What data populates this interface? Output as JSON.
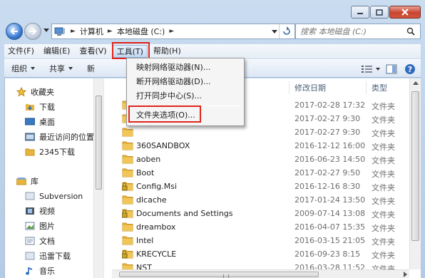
{
  "window": {
    "colors": {
      "accent_red": "#e0261c",
      "folder_yellow": "#e8b53c",
      "nav_blue": "#3a7bd5"
    }
  },
  "address_bar": {
    "crumbs": [
      "计算机",
      "本地磁盘 (C:)"
    ],
    "search_placeholder": "搜索 本地磁盘 (C:)"
  },
  "menubar": {
    "items": [
      {
        "label": "文件(F)"
      },
      {
        "label": "编辑(E)"
      },
      {
        "label": "查看(V)"
      },
      {
        "label": "工具(T)",
        "active": true
      },
      {
        "label": "帮助(H)"
      }
    ]
  },
  "toolbar": {
    "organize": "组织",
    "share": "共享",
    "new_partial": "新"
  },
  "tools_menu": {
    "items": [
      {
        "label": "映射网络驱动器(N)..."
      },
      {
        "label": "断开网络驱动器(D)..."
      },
      {
        "label": "打开同步中心(S)..."
      },
      {
        "label": "文件夹选项(O)...",
        "highlighted": true
      }
    ]
  },
  "nav_pane": {
    "favorites_title": "收藏夹",
    "favorites": [
      "下载",
      "桌面",
      "最近访问的位置",
      "2345下载"
    ],
    "libraries_title": "库",
    "libraries": [
      "Subversion",
      "视频",
      "图片",
      "文档",
      "迅雷下载",
      "音乐"
    ]
  },
  "file_list": {
    "columns": {
      "date": "修改日期",
      "type": "类型"
    },
    "rows": [
      {
        "name": "",
        "date": "2017-02-28 17:32",
        "type": "文件夹",
        "icon": "folder-icon"
      },
      {
        "name": "",
        "date": "2017-02-27 9:30",
        "type": "文件夹",
        "icon": "folder-icon"
      },
      {
        "name": "",
        "date": "2017-02-27 9:30",
        "type": "文件夹",
        "icon": "folder-icon"
      },
      {
        "name": "360SANDBOX",
        "date": "2016-12-12 16:00",
        "type": "文件夹",
        "icon": "folder-icon"
      },
      {
        "name": "aoben",
        "date": "2016-06-23 14:50",
        "type": "文件夹",
        "icon": "folder-icon"
      },
      {
        "name": "Boot",
        "date": "2017-02-27 9:50",
        "type": "文件夹",
        "icon": "folder-icon"
      },
      {
        "name": "Config.Msi",
        "date": "2016-12-16 8:30",
        "type": "文件夹",
        "icon": "locked-folder-icon"
      },
      {
        "name": "dlcache",
        "date": "2017-01-24 13:50",
        "type": "文件夹",
        "icon": "folder-icon"
      },
      {
        "name": "Documents and Settings",
        "date": "2009-07-14 13:08",
        "type": "文件夹",
        "icon": "locked-folder-icon"
      },
      {
        "name": "dreambox",
        "date": "2016-04-07 15:35",
        "type": "文件夹",
        "icon": "folder-icon"
      },
      {
        "name": "Intel",
        "date": "2016-03-15 21:05",
        "type": "文件夹",
        "icon": "folder-icon"
      },
      {
        "name": "KRECYCLE",
        "date": "2016-09-23 8:15",
        "type": "文件夹",
        "icon": "locked-folder-icon"
      },
      {
        "name": "NST",
        "date": "2016-03-28 11:52",
        "type": "文件夹",
        "icon": "folder-icon"
      }
    ]
  }
}
